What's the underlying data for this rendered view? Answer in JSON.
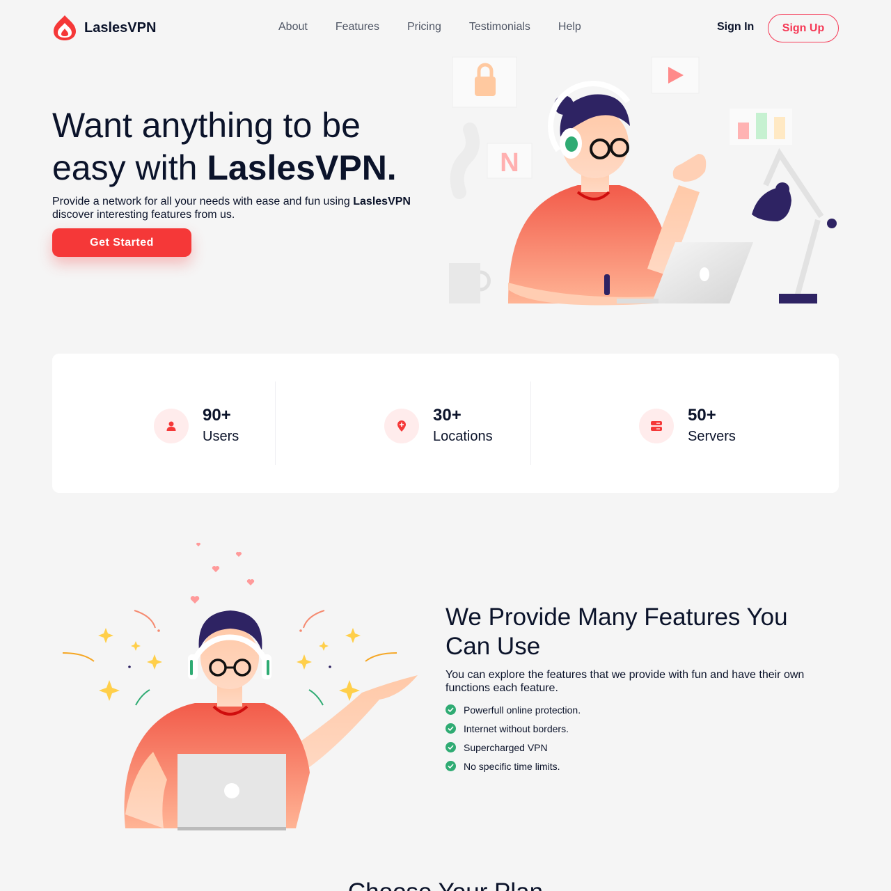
{
  "brand": {
    "name": "LaslesVPN",
    "accent": "#f53838"
  },
  "nav": {
    "items": [
      "About",
      "Features",
      "Pricing",
      "Testimonials",
      "Help"
    ],
    "sign_in": "Sign In",
    "sign_up": "Sign Up"
  },
  "hero": {
    "title_line1": "Want anything to be",
    "title_line2_pre": "easy with ",
    "title_line2_brand": "LaslesVPN.",
    "desc_pre": "Provide a network for all your needs with ease and fun using ",
    "desc_brand": "LaslesVPN",
    "desc_post": " discover interesting features from us.",
    "cta": "Get Started"
  },
  "stats": [
    {
      "value": "90+",
      "label": "Users",
      "icon": "user-icon"
    },
    {
      "value": "30+",
      "label": "Locations",
      "icon": "location-pin-icon"
    },
    {
      "value": "50+",
      "label": "Servers",
      "icon": "server-icon"
    }
  ],
  "features": {
    "title": "We Provide Many Features You Can Use",
    "desc": "You can explore the features that we provide with fun and have their own functions each feature.",
    "items": [
      "Powerfull online protection.",
      "Internet without borders.",
      "Supercharged VPN",
      "No specific time limits."
    ]
  },
  "plans": {
    "title": "Choose Your Plan"
  }
}
